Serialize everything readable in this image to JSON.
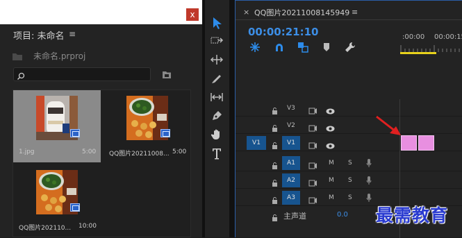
{
  "project": {
    "close_label": "x",
    "title": "项目: 未命名",
    "menu_icon": "≡",
    "file_name": "未命名.prproj",
    "items": [
      {
        "name": "1.jpg",
        "duration": "5:00",
        "selected": true
      },
      {
        "name": "QQ图片20211008...",
        "duration": "5:00",
        "selected": false
      },
      {
        "name": "QQ图片202110...",
        "duration": "10:00",
        "selected": false
      }
    ]
  },
  "tools": [
    "selection-tool",
    "track-select-tool",
    "ripple-edit-tool",
    "razor-tool",
    "slip-tool",
    "pen-tool",
    "hand-tool",
    "type-tool"
  ],
  "timeline": {
    "close_label": "×",
    "sequence_name": "QQ图片20211008145949",
    "menu_icon": "≡",
    "timecode": "00:00:21:10",
    "ruler_labels": [
      ":00:00",
      "00:00:15"
    ],
    "tracks": {
      "v3": "V3",
      "v2": "V2",
      "v1_source": "V1",
      "v1": "V1",
      "a1": "A1",
      "a2": "A2",
      "a3": "A3",
      "m_label": "M",
      "s_label": "S",
      "master": "主声道",
      "master_value": "0.0"
    }
  },
  "watermark": "最需教育",
  "colors": {
    "accent_blue": "#3c8ee6",
    "track_target_blue": "#17548f",
    "clip_pink": "#e88fe0",
    "arrow_red": "#e02020",
    "work_area_yellow": "#e8d21c"
  }
}
